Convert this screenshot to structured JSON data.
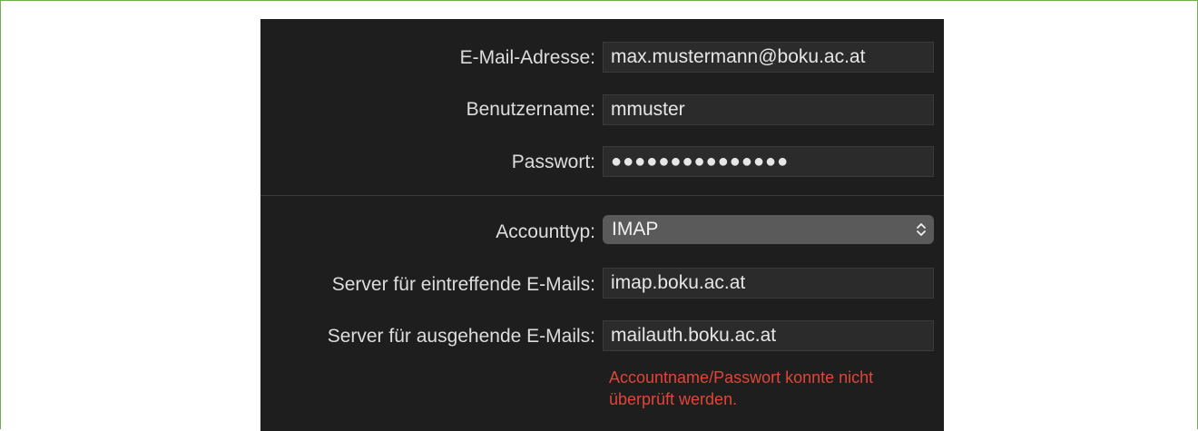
{
  "form": {
    "email_label": "E-Mail-Adresse:",
    "email_value": "max.mustermann@boku.ac.at",
    "username_label": "Benutzername:",
    "username_value": "mmuster",
    "password_label": "Passwort:",
    "password_value": "●●●●●●●●●●●●●●●",
    "account_type_label": "Accounttyp:",
    "account_type_value": "IMAP",
    "incoming_label": "Server für eintreffende E-Mails:",
    "incoming_value": "imap.boku.ac.at",
    "outgoing_label": "Server für ausgehende E-Mails:",
    "outgoing_value": "mailauth.boku.ac.at",
    "error_line1": "Accountname/Passwort konnte nicht",
    "error_line2": "überprüft werden."
  },
  "colors": {
    "frame_border": "#6fb04a",
    "panel_bg": "#1e1e1e",
    "error_text": "#e0453a",
    "select_bg": "#5a5a5a"
  },
  "icons": {
    "select_arrows": "chevron-up-down-icon"
  }
}
